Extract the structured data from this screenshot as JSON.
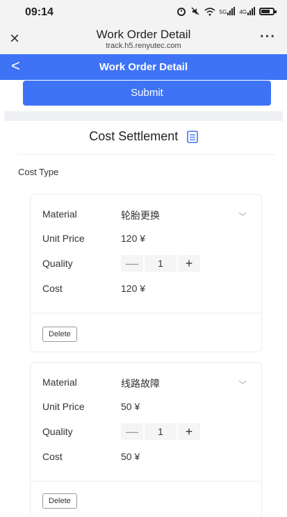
{
  "status_bar": {
    "time": "09:14",
    "icons": [
      "alarm-icon",
      "mute-icon",
      "wifi-icon",
      "signal-5g-icon",
      "signal-4g-icon",
      "battery-icon"
    ],
    "wifi_text": "5G",
    "signal_text": "4G"
  },
  "browser": {
    "title": "Work Order Detail",
    "url": "track.h5.renyutec.com",
    "close_symbol": "×",
    "more_symbol": "···"
  },
  "header": {
    "back_symbol": "<",
    "title": "Work Order Detail",
    "accent_color": "#3f73f6"
  },
  "submit": {
    "label": "Submit"
  },
  "section": {
    "title": "Cost Settlement",
    "cost_type_label": "Cost Type"
  },
  "labels": {
    "material": "Material",
    "unit_price": "Unit Price",
    "quality": "Quality",
    "cost": "Cost",
    "delete": "Delete",
    "minus": "—",
    "plus": "+"
  },
  "items": [
    {
      "material": "轮胎更换",
      "unit_price": "120 ¥",
      "quantity": "1",
      "cost": "120 ¥"
    },
    {
      "material": "线路故障",
      "unit_price": "50 ¥",
      "quantity": "1",
      "cost": "50 ¥"
    }
  ]
}
